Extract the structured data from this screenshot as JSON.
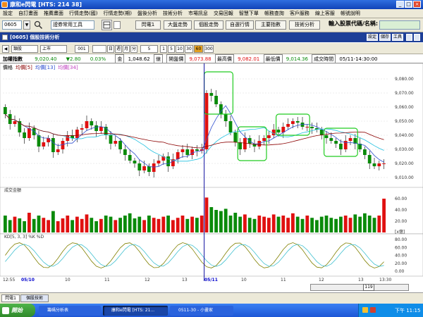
{
  "window": {
    "title": "康和e閃電  [HTS: 214 38]",
    "min": "_",
    "max": "□",
    "close": "×"
  },
  "menu": [
    "設定",
    "自訂畫面",
    "推薦畫面",
    "行情走勢(國)",
    "行情走勢(期)",
    "盤後分析",
    "技術分析",
    "市場訊息",
    "交易回報",
    "智慧下單",
    "帳務查詢",
    "客戶服務",
    "線上客服",
    "帳號說明"
  ],
  "toolbar": {
    "stock_code": "0605",
    "search_icon": "search-icon",
    "dropdown_value": "證券常用工具",
    "buttons": [
      "閃電1",
      "大盤走勢",
      "個股走勢",
      "自選行情",
      "主要指數",
      "技術分析"
    ],
    "input_label": "輸入股票代碼/名稱:",
    "input_value": ""
  },
  "chart_panel": {
    "title": "[0605] 個股技術分析",
    "right_buttons": [
      "設定",
      "儲存",
      "工具"
    ]
  },
  "period_bar": {
    "type": "類股",
    "market": "上市",
    "code": "001",
    "periods": [
      "日",
      "週",
      "月",
      "分"
    ],
    "minute": "5",
    "intervals": [
      "1",
      "5",
      "10",
      "30"
    ],
    "selected": "60",
    "last": "300"
  },
  "infobar": {
    "name": "加權指數",
    "price": "9,020.40",
    "change": "▼2.80",
    "pct": "0.03%",
    "amount_label": "金",
    "amount": "1,048.62",
    "unit": "億",
    "open_label": "開盤價",
    "open": "9,073.88",
    "high_label": "最高價",
    "high": "9,082.01",
    "low_label": "最低價",
    "low": "9,014.36",
    "time_label": "成交時間",
    "time": "05/11-14:30:00"
  },
  "colors": {
    "up": "#e01010",
    "down": "#0a8a0a",
    "ma1": "#8b0000",
    "ma2": "#3050d0",
    "ma3": "#20c0e0",
    "k": "#808000",
    "d": "#40c0d0",
    "highlight": "#22cc22"
  },
  "chart_data": [
    {
      "type": "candlestick",
      "legend": [
        "價格",
        "均價[5]",
        "均價[13]",
        "均價[34]"
      ],
      "y_ticks": [
        "9,080.00",
        "9,070.00",
        "9,060.00",
        "9,050.00",
        "9,040.00",
        "9,030.00",
        "9,020.00",
        "9,010.00"
      ],
      "ylim": [
        9005,
        9086
      ],
      "open": [
        9060,
        9055,
        9048,
        9050,
        9042,
        9038,
        9045,
        9040,
        9032,
        9035,
        9038,
        9028,
        9030,
        9036,
        9040,
        9038,
        9044,
        9045,
        9050,
        9047,
        9043,
        9046,
        9040,
        9034,
        9036,
        9030,
        9026,
        9022,
        9020,
        9015,
        9018,
        9014,
        9020,
        9022,
        9025,
        9018,
        9023,
        9028,
        9030,
        9026,
        9030,
        9029,
        9030,
        9070,
        9068,
        9062,
        9055,
        9050,
        9042,
        9035,
        9030,
        9038,
        9034,
        9032,
        9036,
        9038,
        9040,
        9044,
        9042,
        9046,
        9048,
        9050,
        9049,
        9046,
        9046,
        9045,
        9044,
        9040,
        9038,
        9036,
        9034,
        9030,
        9036,
        9038,
        9034,
        9030,
        9026,
        9020,
        9018,
        9020
      ],
      "close": [
        9055,
        9048,
        9050,
        9042,
        9038,
        9045,
        9040,
        9032,
        9035,
        9038,
        9028,
        9030,
        9036,
        9040,
        9038,
        9044,
        9045,
        9050,
        9047,
        9043,
        9046,
        9040,
        9034,
        9036,
        9030,
        9026,
        9022,
        9020,
        9015,
        9018,
        9014,
        9020,
        9022,
        9025,
        9018,
        9023,
        9028,
        9030,
        9026,
        9030,
        9029,
        9030,
        9070,
        9068,
        9062,
        9055,
        9050,
        9042,
        9035,
        9030,
        9038,
        9034,
        9032,
        9036,
        9038,
        9040,
        9044,
        9042,
        9046,
        9048,
        9050,
        9049,
        9046,
        9046,
        9045,
        9044,
        9040,
        9038,
        9036,
        9034,
        9030,
        9036,
        9038,
        9034,
        9030,
        9026,
        9020,
        9018,
        9020,
        9020
      ],
      "volume": [
        30,
        22,
        28,
        25,
        20,
        35,
        24,
        30,
        26,
        22,
        38,
        20,
        25,
        30,
        22,
        28,
        24,
        32,
        26,
        20,
        24,
        30,
        28,
        22,
        26,
        30,
        34,
        25,
        28,
        22,
        30,
        26,
        24,
        28,
        30,
        22,
        26,
        30,
        24,
        28,
        26,
        30,
        62,
        45,
        40,
        38,
        42,
        30,
        35,
        28,
        32,
        26,
        24,
        30,
        28,
        26,
        32,
        28,
        30,
        26,
        34,
        28,
        24,
        30,
        26,
        22,
        28,
        30,
        26,
        24,
        28,
        30,
        26,
        32,
        28,
        34,
        30,
        26,
        30,
        60
      ],
      "vol_ticks": [
        "60.00",
        "40.00",
        "20.00"
      ],
      "vol_label": "成交金額",
      "vol_unit": "[x億]",
      "kd_label": "KD[5, 3, 3]  %K  %D",
      "kd_ticks": [
        "80.00",
        "60.00",
        "40.00",
        "20.00",
        "0.00"
      ],
      "x_labels": [
        "12:55",
        "05/10",
        "10",
        "11",
        "12",
        "13",
        "05/11",
        "10",
        "11",
        "12",
        "13",
        "13:30"
      ]
    }
  ],
  "bottom": {
    "tabs": [
      "閃電1",
      "個股技術"
    ],
    "scroll_value": "119"
  },
  "taskbar": {
    "start": "開始",
    "tasks": [
      "籌碼分析表",
      "康和e閃電 [HTS: 21...",
      "0511-30 - 小畫家"
    ],
    "clock": "下午 11:15"
  }
}
